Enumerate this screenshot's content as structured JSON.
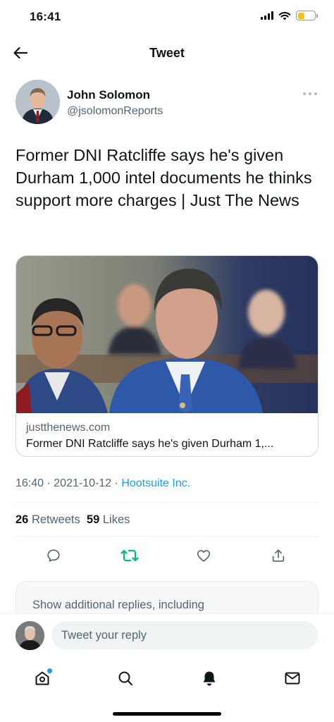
{
  "status_bar": {
    "time": "16:41",
    "icons": [
      "signal-icon",
      "wifi-icon",
      "battery-icon"
    ],
    "battery_color": "#f2c51b",
    "battery_level": 0.4
  },
  "header": {
    "title": "Tweet",
    "back_icon": "arrow-left-icon"
  },
  "tweet": {
    "author": {
      "name": "John Solomon",
      "handle": "@jsolomonReports"
    },
    "text": "Former DNI Ratcliffe says he's given Durham 1,000 intel documents he thinks support more charges | Just The News",
    "card": {
      "domain": "justthenews.com",
      "title": "Former DNI Ratcliffe says he's given Durham 1,..."
    },
    "meta": {
      "time": "16:40",
      "separator": " · ",
      "date": "2021-10-12",
      "source": "Hootsuite Inc."
    },
    "stats": {
      "retweets_count": "26",
      "retweets_label": "Retweets",
      "likes_count": "59",
      "likes_label": "Likes"
    },
    "actions": [
      "reply-icon",
      "retweet-icon",
      "like-icon",
      "share-icon"
    ],
    "retweet_color": "#00ba7c"
  },
  "more_replies": {
    "label": "Show additional replies, including"
  },
  "reply_bar": {
    "placeholder": "Tweet your reply"
  },
  "bottom_nav": {
    "items": [
      "home-icon",
      "search-icon",
      "notifications-icon",
      "messages-icon"
    ],
    "accent": "#1d9bf0"
  }
}
